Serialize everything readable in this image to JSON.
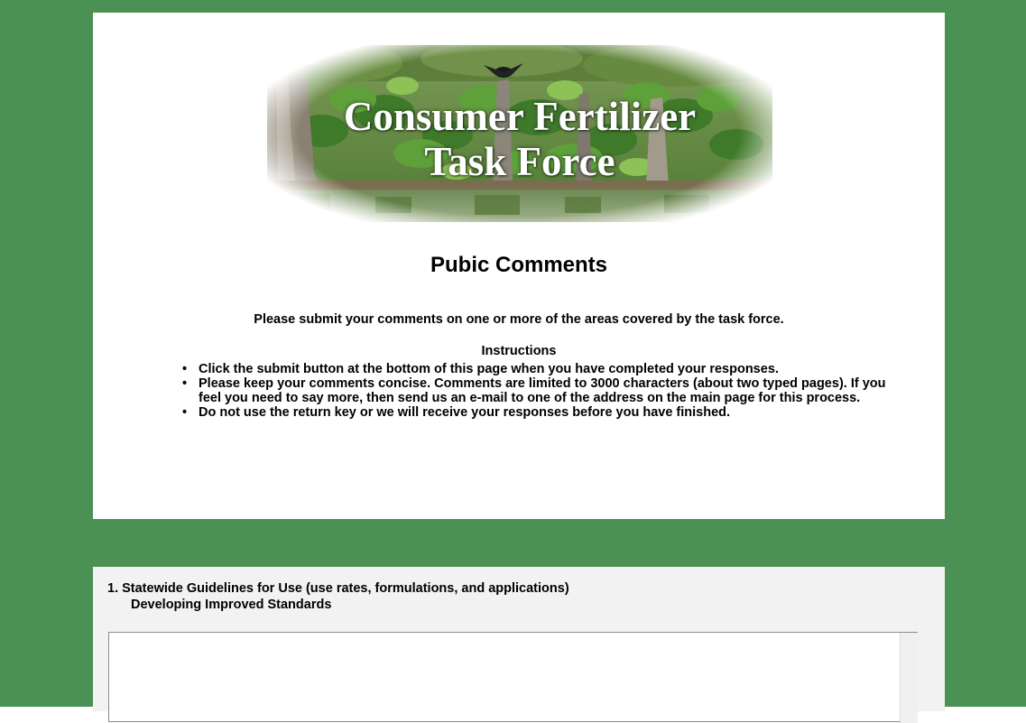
{
  "colors": {
    "page_background": "#4b9153",
    "card_background": "#ffffff",
    "question_card_background": "#f2f2f2"
  },
  "banner": {
    "title_line1": "Consumer Fertilizer",
    "title_line2": "Task Force"
  },
  "header": {
    "title": "Pubic Comments",
    "intro": "Please submit your comments on one or more of the areas covered by the task force.",
    "instructions_heading": "Instructions",
    "instructions": [
      "Click the submit button at the bottom of this page when you have completed your responses.",
      "Please keep your comments concise. Comments are limited to 3000 characters (about two typed pages). If you feel you need to say more, then send us an e-mail to one of the address on the main page for this process.",
      "Do not use the return key or we will receive your responses before you have finished."
    ]
  },
  "questions": [
    {
      "title": "1. Statewide Guidelines for Use (use rates, formulations, and applications)",
      "subtitle": "Developing Improved Standards",
      "value": ""
    }
  ]
}
